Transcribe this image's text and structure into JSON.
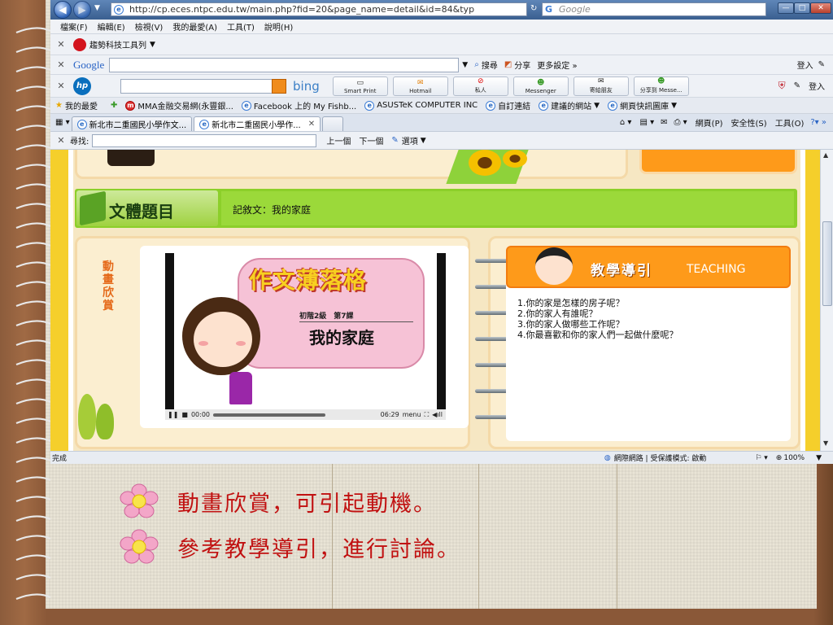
{
  "browser": {
    "url": "http://cp.eces.ntpc.edu.tw/main.php?fid=20&page_name=detail&id=84&typ",
    "search_placeholder": "Google",
    "menu": [
      "檔案(F)",
      "編輯(E)",
      "檢視(V)",
      "我的最愛(A)",
      "工具(T)",
      "說明(H)"
    ],
    "toolbar1_label": "趨勢科技工具列",
    "google_toolbar": {
      "logo": "Google",
      "search": "搜尋",
      "share": "分享",
      "more": "更多設定 »",
      "login": "登入"
    },
    "hp_toolbar": {
      "bing": "bing",
      "buttons": [
        "Smart Print",
        "Hotmail",
        "私人",
        "Messenger",
        "寄給朋友",
        "分享到 Messe..."
      ],
      "login": "登入"
    },
    "favorites": {
      "label": "我的最愛",
      "items": [
        "MMA金融交易網(永豐銀...",
        "Facebook 上的 My Fishb...",
        "ASUSTeK COMPUTER INC",
        "自訂連結",
        "建議的網站",
        "網頁快訊圖庫"
      ]
    },
    "tabs": [
      "新北市二重國民小學作文...",
      "新北市二重國民小學作..."
    ],
    "command_bar": [
      "網頁(P)",
      "安全性(S)",
      "工具(O)"
    ],
    "find_bar": {
      "label": "尋找:",
      "prev": "上一個",
      "next": "下一個",
      "options": "選項"
    },
    "status": {
      "left": "完成",
      "zone": "網際網路 | 受保護模式: 啟動",
      "zoom": "100%"
    }
  },
  "page": {
    "genre_title": "文體題目",
    "genre_value": "記敘文：我的家庭",
    "animation_label": "動畫欣賞",
    "video": {
      "title": "作文薄落格",
      "lesson": "初階2級　第7課",
      "subtitle": "我的家庭",
      "time_current": "00:00",
      "time_total": "06:29",
      "menu": "menu"
    },
    "teaching": {
      "title": "教學導引",
      "title_en": "TEACHING",
      "questions": [
        "1.你的家是怎樣的房子呢？",
        "2.你的家人有誰呢？",
        "3.你的家人做哪些工作呢？",
        "4.你最喜歡和你的家人們一起做什麼呢？"
      ]
    }
  },
  "slide": {
    "bullets": [
      "動畫欣賞，可引起動機。",
      "參考教學導引，進行討論。"
    ]
  },
  "colors": {
    "bullet_text": "#c11111",
    "teaching_header": "#fe9a1a",
    "genre_bar": "#8ccf2a"
  }
}
